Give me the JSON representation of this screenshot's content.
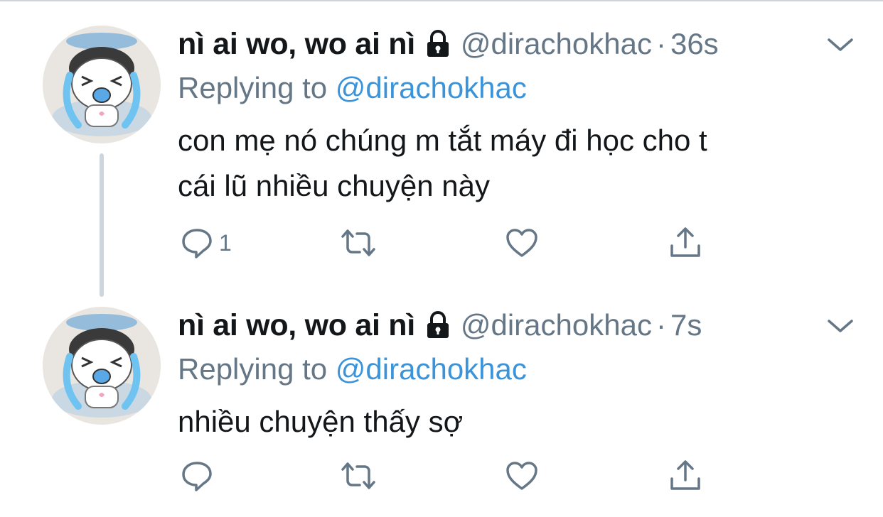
{
  "tweets": [
    {
      "display_name": "nì ai wo, wo ai nì",
      "handle": "@dirachokhac",
      "separator": "·",
      "time": "36s",
      "replying_prefix": "Replying to ",
      "replying_to": "@dirachokhac",
      "text_lines": [
        "con mẹ nó chúng m tắt máy đi học cho t",
        "cái lũ nhiều chuyện này"
      ],
      "reply_count": "1"
    },
    {
      "display_name": "nì ai wo, wo ai nì",
      "handle": "@dirachokhac",
      "separator": "·",
      "time": "7s",
      "replying_prefix": "Replying to ",
      "replying_to": "@dirachokhac",
      "text_lines": [
        "nhiều chuyện thấy sợ"
      ],
      "reply_count": ""
    }
  ],
  "icons": {
    "lock": "lock-icon",
    "more": "chevron-down-icon",
    "reply": "speech-bubble-icon",
    "retweet": "retweet-icon",
    "like": "heart-icon",
    "share": "share-icon"
  },
  "colors": {
    "text_primary": "#14171a",
    "text_secondary": "#657786",
    "link": "#3b94d9",
    "thread_line": "#cdd6dd"
  }
}
